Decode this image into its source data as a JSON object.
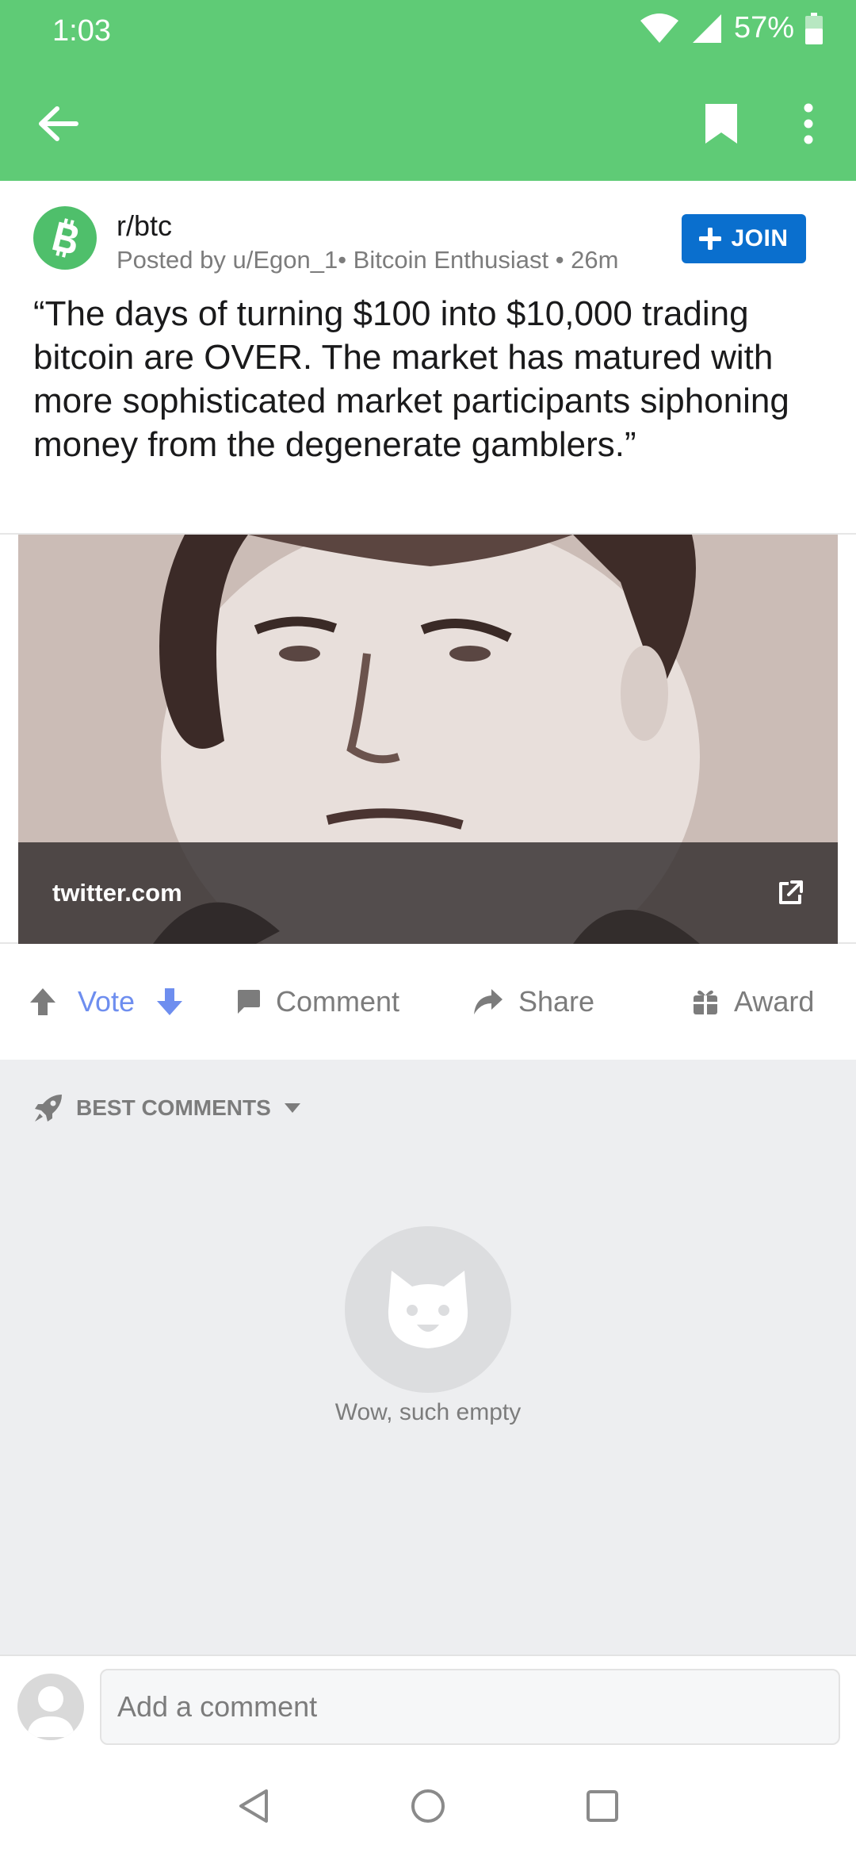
{
  "status_bar": {
    "time": "1:03",
    "battery": "57%"
  },
  "app_bar": {
    "back_icon": "arrow-left-icon",
    "bookmark_icon": "bookmark-icon",
    "more_icon": "more-vertical-icon"
  },
  "post": {
    "subreddit": "r/btc",
    "meta": "Posted by u/Egon_1• Bitcoin Enthusiast • 26m",
    "join_label": "JOIN",
    "title": "“The days of turning $100 into $10,000 trading bitcoin are OVER. The market has matured with more sophisticated market participants siphoning money from the degenerate gamblers.”",
    "link_domain": "twitter.com"
  },
  "actions": {
    "vote": "Vote",
    "comment": "Comment",
    "share": "Share",
    "award": "Award"
  },
  "comments": {
    "sort_label": "BEST COMMENTS",
    "empty_text": "Wow, such empty"
  },
  "comment_input": {
    "placeholder": "Add a comment"
  },
  "colors": {
    "app_bar": "#5fcb76",
    "join_button": "#0a6fce",
    "vote_accent": "#6e8eef"
  }
}
